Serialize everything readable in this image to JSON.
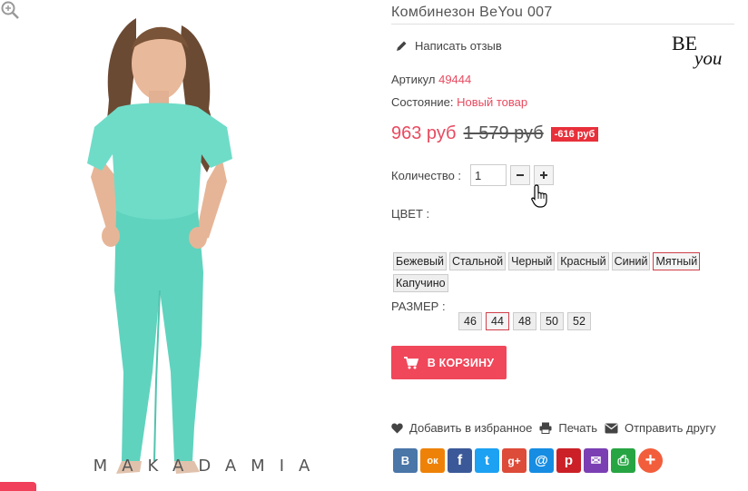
{
  "product": {
    "title": "Комбинезон BeYou 007",
    "review_link": "Написать отзыв",
    "brand_logo": {
      "top": "BE",
      "bottom": "you"
    },
    "sku_label": "Артикул",
    "sku_value": "49444",
    "condition_label": "Состояние:",
    "condition_value": "Новый товар",
    "price_new": "963 руб",
    "price_old": "1 579 руб",
    "discount": "-616 руб",
    "quantity_label": "Количество :",
    "quantity_value": "1",
    "color_label": "ЦВЕТ :",
    "colors": [
      "Бежевый",
      "Стальной",
      "Черный",
      "Красный",
      "Синий",
      "Мятный",
      "Капучино"
    ],
    "selected_color": "Мятный",
    "size_label": "РАЗМЕР :",
    "sizes": [
      "46",
      "44",
      "48",
      "50",
      "52"
    ],
    "selected_size": "44",
    "add_to_cart": "В КОРЗИНУ"
  },
  "actions": {
    "wishlist": "Добавить в избранное",
    "print": "Печать",
    "send": "Отправить другу"
  },
  "photo": {
    "watermark": "MAKADAMIA",
    "garment_color": "#6fdcc8"
  },
  "share": [
    {
      "name": "vk-icon",
      "glyph": "В",
      "color": "#4a76a8"
    },
    {
      "name": "ok-icon",
      "glyph": "ок",
      "color": "#ee8208"
    },
    {
      "name": "facebook-icon",
      "glyph": "f",
      "color": "#3b5998"
    },
    {
      "name": "twitter-icon",
      "glyph": "t",
      "color": "#1da1f2"
    },
    {
      "name": "google-plus-icon",
      "glyph": "g+",
      "color": "#dd4b39"
    },
    {
      "name": "mail-icon",
      "glyph": "@",
      "color": "#168de2"
    },
    {
      "name": "pinterest-icon",
      "glyph": "p",
      "color": "#cb2027"
    },
    {
      "name": "email-icon",
      "glyph": "✉",
      "color": "#7b3fb3"
    },
    {
      "name": "print-icon",
      "glyph": "⎙",
      "color": "#27a543"
    },
    {
      "name": "more-icon",
      "glyph": "+",
      "color": "#f25e3c"
    }
  ],
  "colors": {
    "accent": "#f0475a",
    "price": "#e84a5f",
    "discount_bg": "#e8303a"
  }
}
